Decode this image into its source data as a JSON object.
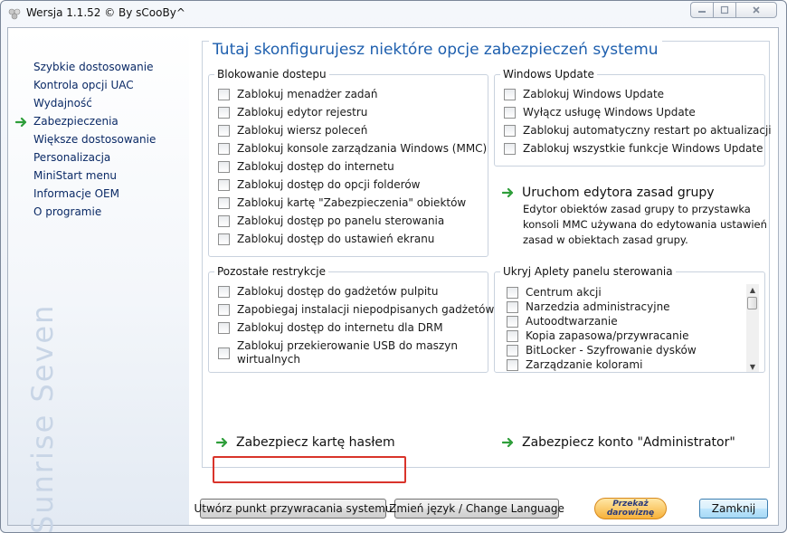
{
  "window": {
    "title": "Wersja 1.1.52 © By sCooBy^"
  },
  "sidebar": {
    "items": [
      {
        "label": "Szybkie dostosowanie"
      },
      {
        "label": "Kontrola opcji UAC"
      },
      {
        "label": "Wydajność"
      },
      {
        "label": "Zabezpieczenia",
        "active": true
      },
      {
        "label": "Większe dostosowanie"
      },
      {
        "label": "Personalizacja"
      },
      {
        "label": "MiniStart menu"
      },
      {
        "label": "Informacje OEM"
      },
      {
        "label": "O programie"
      }
    ],
    "brand": "Sunrise Seven"
  },
  "main": {
    "title": "Tutaj skonfigurujesz niektóre opcje zabezpieczeń systemu",
    "blokowanie": {
      "title": "Blokowanie dostepu",
      "items": [
        "Zablokuj menadżer zadań",
        "Zablokuj edytor rejestru",
        "Zablokuj wiersz poleceń",
        "Zablokuj konsole zarządzania Windows (MMC)",
        "Zablokuj dostęp do internetu",
        "Zablokuj dostęp do opcji folderów",
        "Zablokuj kartę \"Zabezpieczenia\" obiektów",
        "Zablokuj dostęp po panelu sterowania",
        "Zablokuj dostęp do ustawień ekranu"
      ]
    },
    "windows_update": {
      "title": "Windows Update",
      "items": [
        "Zablokuj Windows Update",
        "Wyłącz usługę Windows Update",
        "Zablokuj automatyczny restart po aktualizacji",
        "Zablokuj wszystkie funkcje Windows Update"
      ]
    },
    "gpo": {
      "link": "Uruchom edytora zasad grupy",
      "description": "Edytor obiektów zasad grupy to przystawka konsoli MMC używana do edytowania ustawień zasad w obiektach zasad grupy."
    },
    "pozostale": {
      "title": "Pozostałe restrykcje",
      "items": [
        "Zablokuj dostęp do gadżetów pulpitu",
        "Zapobiegaj instalacji niepodpisanych gadżetów",
        "Zablokuj dostęp do internetu dla DRM",
        "Zablokuj przekierowanie USB do maszyn",
        "wirtualnych"
      ]
    },
    "aplety": {
      "title": "Ukryj Aplety panelu sterowania",
      "items": [
        "Centrum akcji",
        "Narzedzia administracyjne",
        "Autoodtwarzanie",
        "Kopia zapasowa/przywracanie",
        "BitLocker - Szyfrowanie dysków",
        "Zarządzanie kolorami"
      ]
    },
    "secure_card": "Zabezpiecz kartę hasłem",
    "secure_admin": "Zabezpiecz konto \"Administrator\""
  },
  "footer": {
    "restore_point": "Utwórz punkt przywracania systemu",
    "change_language": "Zmień język / Change Language",
    "donate_line1": "Przekaż",
    "donate_line2": "darowiznę",
    "close": "Zamknij"
  },
  "colors": {
    "accent": "#1e5fae",
    "arrow_green": "#2e9e3a",
    "highlight": "#d9342b"
  }
}
